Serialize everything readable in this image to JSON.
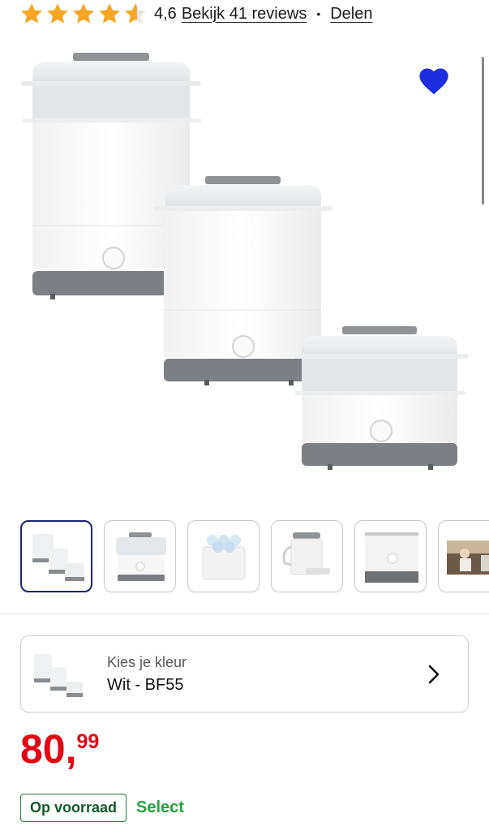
{
  "rating": {
    "value": "4,6",
    "stars_filled": 4.6,
    "star_color": "#f5a623",
    "reviews_link": "Bekijk 41 reviews",
    "separator": "•",
    "share_link": "Delen"
  },
  "favorite": {
    "icon": "heart-icon",
    "color": "#1c2ee0"
  },
  "gallery": {
    "thumbnail_count": 6,
    "active_index": 0
  },
  "color_selector": {
    "label": "Kies je kleur",
    "value": "Wit - BF55"
  },
  "price": {
    "integer": "80",
    "separator": ",",
    "decimals": "99",
    "color": "#e30613"
  },
  "stock": {
    "badge": "Op voorraad",
    "badge_color": "#1f7a3d",
    "select_label": "Select",
    "select_color": "#23a33c"
  }
}
